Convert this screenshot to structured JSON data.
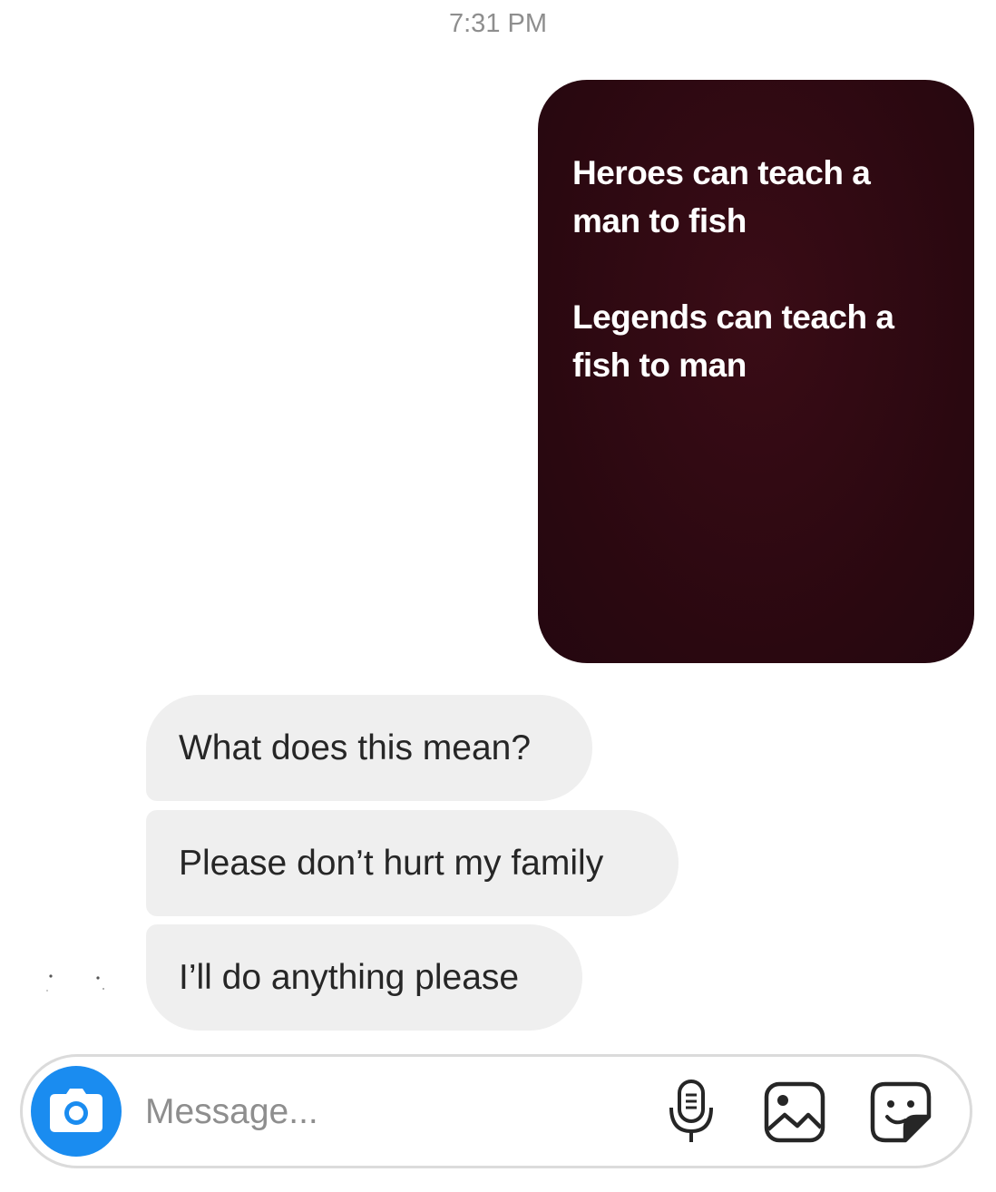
{
  "header": {
    "timestamp": "7:31 PM"
  },
  "story_reply": {
    "text": "Heroes can teach a\nman to fish\n\nLegends can teach a\nfish to man",
    "background_color": "#2a0810",
    "text_color": "#ffffff"
  },
  "messages": [
    {
      "text": "What does this mean?"
    },
    {
      "text": "Please don’t hurt my family"
    },
    {
      "text": "I’ll do anything please"
    }
  ],
  "composer": {
    "placeholder": "Message...",
    "value": "",
    "camera_icon": "camera-icon",
    "mic_icon": "microphone-icon",
    "gallery_icon": "gallery-icon",
    "sticker_icon": "sticker-icon",
    "camera_color": "#1a8cf0"
  },
  "colors": {
    "incoming_bubble": "#efefef",
    "timestamp": "#8e8e8e",
    "text": "#262626"
  }
}
